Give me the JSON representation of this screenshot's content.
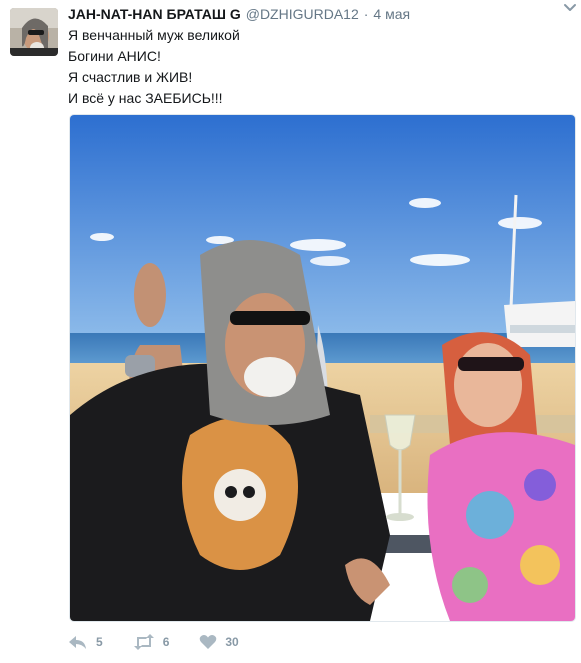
{
  "tweet": {
    "display_name": "JAH-NAT-HAN БРАТАШ G",
    "username": "@DZHIGURDA12",
    "separator": "·",
    "date": "4 мая",
    "text_lines": [
      "Я венчанный муж великой",
      "Богини АНИС!",
      "Я счастлив и ЖИВ!",
      "И всё у нас ЗАЕБИСЬ!!!"
    ],
    "media_icon": "photo-beach-couple",
    "actions": {
      "reply_count": "5",
      "retweet_count": "6",
      "like_count": "30"
    }
  },
  "icons": {
    "reply": "reply-icon",
    "retweet": "retweet-icon",
    "like": "heart-icon",
    "menu": "chevron-down-icon"
  },
  "colors": {
    "text": "#14171a",
    "muted": "#657786",
    "action": "#aab8c2",
    "sky": "#3a7fd1",
    "sand": "#e8c995"
  }
}
